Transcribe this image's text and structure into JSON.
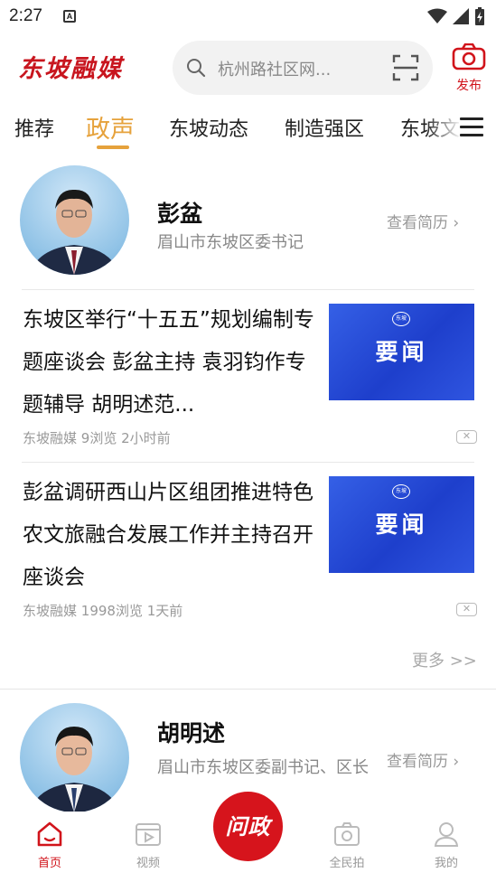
{
  "status_bar": {
    "time": "2:27",
    "notification_icon": "A"
  },
  "header": {
    "logo": "东坡融媒",
    "search_placeholder": "杭州路社区网...",
    "publish_label": "发布"
  },
  "tabs": [
    {
      "label": "推荐",
      "active": false
    },
    {
      "label": "政声",
      "active": true
    },
    {
      "label": "东坡动态",
      "active": false
    },
    {
      "label": "制造强区",
      "active": false
    },
    {
      "label": "东坡文",
      "active": false
    }
  ],
  "leaders": [
    {
      "name": "彭盆",
      "title": "眉山市东坡区委书记",
      "resume_link": "查看简历 ›"
    },
    {
      "name": "胡明述",
      "title": "眉山市东坡区委副书记、区长",
      "resume_link": "查看简历 ›"
    }
  ],
  "news": [
    {
      "title": "东坡区举行“十五五”规划编制专题座谈会 彭盆主持 袁羽钧作专题辅导 胡明述范...",
      "source": "东坡融媒",
      "views": "9浏览",
      "time": "2小时前",
      "thumb_text": "要闻",
      "thumb_badge": "东坡"
    },
    {
      "title": "彭盆调研西山片区组团推进特色农文旅融合发展工作并主持召开座谈会",
      "source": "东坡融媒",
      "views": "1998浏览",
      "time": "1天前",
      "thumb_text": "要闻",
      "thumb_badge": "东坡"
    }
  ],
  "more_link": "更多 >>",
  "bottom_nav": {
    "home": "首页",
    "video": "视频",
    "center": "问政",
    "photo": "全民拍",
    "mine": "我的"
  },
  "colors": {
    "brand_red": "#d1141b",
    "tab_active": "#e6a23c",
    "thumb_blue": "#2a4fdc"
  }
}
